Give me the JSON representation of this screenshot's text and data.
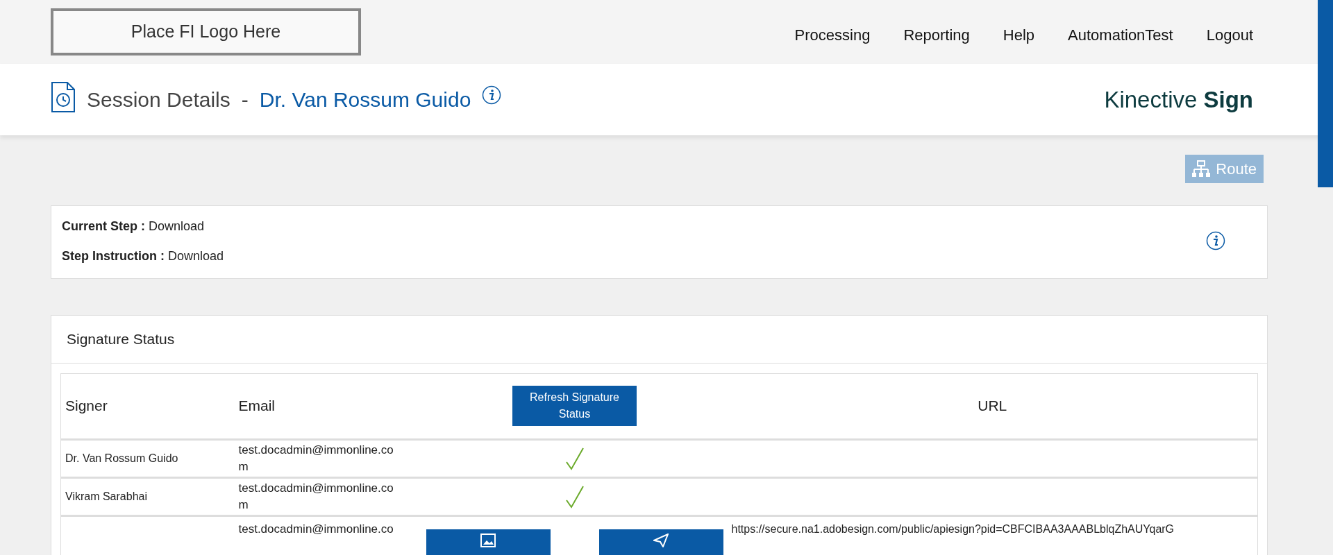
{
  "header": {
    "logo": "Place FI Logo Here",
    "nav": [
      "Processing",
      "Reporting",
      "Help",
      "AutomationTest",
      "Logout"
    ]
  },
  "page_title": {
    "label": "Session Details",
    "separator": "-",
    "name": "Dr. Van Rossum Guido"
  },
  "brand": "Kinective **Sign**",
  "route_button": {
    "label": "Route",
    "disabled": true
  },
  "step": [
    {
      "label": "Current Step :",
      "value": "Download"
    },
    {
      "label": "Step Instruction :",
      "value": "Download"
    }
  ],
  "signature_status": {
    "title": "Signature Status",
    "columns": [
      {
        "kind": "text",
        "label": "Signer"
      },
      {
        "kind": "text",
        "label": "Email"
      },
      {
        "kind": "button",
        "label": "Refresh Signature Status"
      },
      {
        "kind": "text",
        "label": "URL"
      }
    ],
    "rows": [
      {
        "signer": "Dr. Van Rossum Guido",
        "email": "test.docadmin@immonline.com",
        "signed": true
      },
      {
        "signer": "Vikram Sarabhai",
        "email": "test.docadmin@immonline.com",
        "signed": true
      },
      {
        "email": "test.docadmin@immonline.co",
        "signed": false,
        "url": "https://secure.na1.adobesign.com/public/apiesign?pid=CBFCIBAA3AAABLblqZhAUYqarG"
      }
    ]
  }
}
